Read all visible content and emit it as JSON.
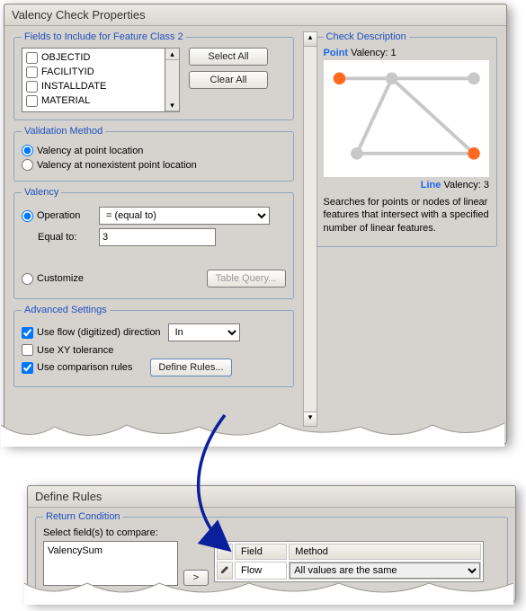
{
  "window_title": "Valency Check Properties",
  "fields_section": {
    "legend": "Fields to Include for Feature Class 2",
    "items": [
      "OBJECTID",
      "FACILITYID",
      "INSTALLDATE",
      "MATERIAL"
    ],
    "select_all": "Select All",
    "clear_all": "Clear All"
  },
  "validation_method": {
    "legend": "Validation Method",
    "opt_point": "Valency at point location",
    "opt_nonexistent": "Valency at nonexistent point location",
    "selected": "point"
  },
  "valency": {
    "legend": "Valency",
    "operation_label": "Operation",
    "operation_value": "= (equal to)",
    "equal_to_label": "Equal to:",
    "equal_to_value": "3",
    "customize_label": "Customize",
    "table_query_btn": "Table Query..."
  },
  "advanced": {
    "legend": "Advanced Settings",
    "flow_label": "Use flow (digitized) direction",
    "flow_value": "In",
    "flow_checked": true,
    "xy_label": "Use XY tolerance",
    "xy_checked": false,
    "compare_label": "Use comparison rules",
    "compare_checked": true,
    "define_rules_btn": "Define Rules..."
  },
  "description": {
    "legend": "Check Description",
    "point_label": "Point",
    "point_valency": "Valency: 1",
    "line_label": "Line",
    "line_valency": "Valency: 3",
    "text": "Searches for points or nodes of linear features that intersect with a specified number of linear features."
  },
  "define_rules": {
    "title": "Define Rules",
    "return_legend": "Return Condition",
    "select_fields_label": "Select field(s) to compare:",
    "available_field": "ValencySum",
    "move_btn": ">",
    "col_field": "Field",
    "col_method": "Method",
    "row_field": "Flow",
    "row_method": "All values are the same"
  }
}
